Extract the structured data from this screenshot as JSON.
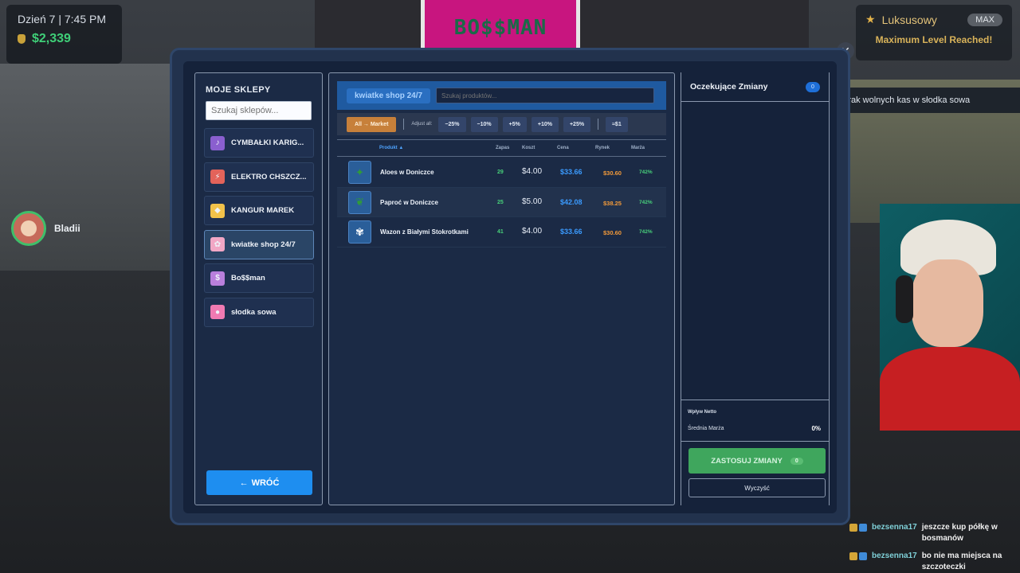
{
  "hud": {
    "day_time": "Dzień 7 | 7:45 PM",
    "money": "$2,339",
    "level_name": "Luksusowy",
    "level_badge": "MAX",
    "level_message": "Maximum Level Reached!"
  },
  "scene": {
    "store_sign": "BO$$MAN"
  },
  "player": {
    "name": "Bladii"
  },
  "notification": {
    "text": "Brak wolnych kas w słodka sowa"
  },
  "shops_panel": {
    "title": "MOJE SKLEPY",
    "search_placeholder": "Szukaj sklepów...",
    "items": [
      {
        "label": "CYMBAŁKI KARIG...",
        "icon": "guitar-icon",
        "color": "#8a5fcf"
      },
      {
        "label": "ELEKTRO CHSZCZ...",
        "icon": "electronics-icon",
        "color": "#e3635a"
      },
      {
        "label": "KANGUR MAREK",
        "icon": "kangaroo-icon",
        "color": "#f2c24a"
      },
      {
        "label": "kwiatke shop 24/7",
        "icon": "flower-icon",
        "color": "#f1a7c5",
        "active": true
      },
      {
        "label": "Bo$$man",
        "icon": "bag-icon",
        "color": "#b97fdc"
      },
      {
        "label": "słodka sowa",
        "icon": "owl-icon",
        "color": "#f07ab2"
      }
    ],
    "back_label": "WRÓĆ",
    "back_arrow": "←"
  },
  "products_panel": {
    "shop_tab": "kwiatke shop 24/7",
    "search_placeholder": "Szukaj produktów...",
    "market_button": "All → Market",
    "adjust_label": "Adjust all:",
    "adjust_buttons": [
      "−25%",
      "−10%",
      "+5%",
      "+10%",
      "+25%"
    ],
    "round_button": "≈$1",
    "columns": {
      "product": "Produkt ▲",
      "stock": "Zapas",
      "cost": "Koszt",
      "price": "Cena",
      "market": "Rynek",
      "margin": "Marża"
    },
    "rows": [
      {
        "name": "Aloes w Doniczce",
        "stock": "29",
        "cost": "$4.00",
        "price": "$33.66",
        "market": "$30.60",
        "margin": "742%",
        "icon": "aloe-icon"
      },
      {
        "name": "Paproć w Doniczce",
        "stock": "25",
        "cost": "$5.00",
        "price": "$42.08",
        "market": "$38.25",
        "margin": "742%",
        "icon": "fern-icon"
      },
      {
        "name": "Wazon z Białymi Stokrotkami",
        "stock": "41",
        "cost": "$4.00",
        "price": "$33.66",
        "market": "$30.60",
        "margin": "742%",
        "icon": "daisy-vase-icon"
      }
    ]
  },
  "pending_panel": {
    "title": "Oczekujące Zmiany",
    "count": "0",
    "net_label": "Wpływ Netto",
    "avg_label": "Średnia Marża",
    "avg_value": "0%",
    "apply_label": "ZASTOSUJ ZMIANY",
    "apply_count": "0",
    "clear_label": "Wyczyść"
  },
  "chat": [
    {
      "user": "bezsenna17",
      "message": "jeszcze kup półkę w bosmanów"
    },
    {
      "user": "bezsenna17",
      "message": "bo nie ma miejsca na szczoteczki"
    }
  ],
  "colors": {
    "accent": "#1e8ef0",
    "apply": "#3fa65d",
    "price": "#3b9bff",
    "market": "#f29a3a",
    "margin": "#48d07a"
  }
}
